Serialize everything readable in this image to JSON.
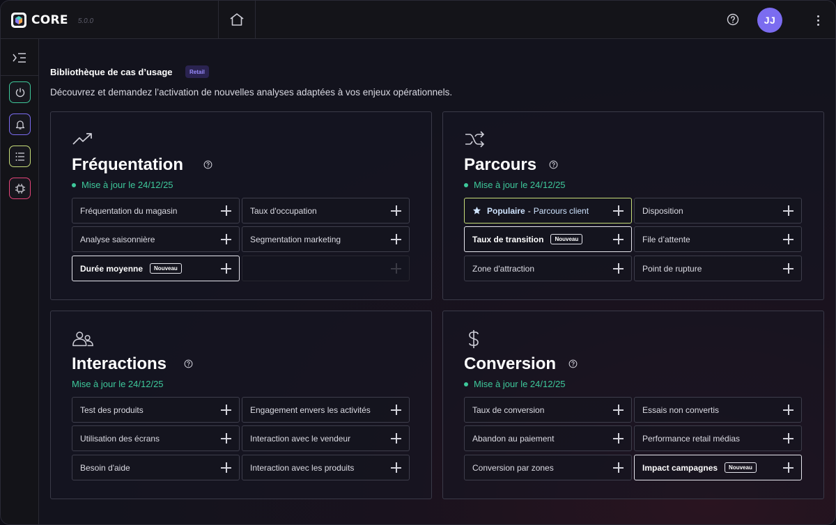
{
  "app": {
    "name": "CORE",
    "version": "5.0.0",
    "avatar_initials": "JJ",
    "accent": "#7b6cf0"
  },
  "icons": {
    "home": "home-icon",
    "help": "help-circle-icon",
    "menu": "kebab-menu-icon",
    "sidebar_toggle": "sidebar-expand-icon",
    "power": "power-icon",
    "bell": "bell-icon",
    "list": "list-icon",
    "chip": "chip-icon"
  },
  "library": {
    "title": "Bibliothèque de cas d’usage",
    "badge": "Retail",
    "description": "Découvrez et demandez l’activation de nouvelles analyses adaptées à vos enjeux opérationnels."
  },
  "labels": {
    "new": "Nouveau",
    "popular": "Populaire",
    "popular_sep": "-"
  },
  "sections": {
    "frequentation": {
      "title": "Fréquentation",
      "icon": "trending-up-icon",
      "status": "Mise à jour le 24/12/25",
      "items": [
        "Fréquentation du magasin",
        "Taux d'occupation",
        "Analyse saisonnière",
        "Segmentation marketing",
        "Durée moyenne"
      ]
    },
    "parcours": {
      "title": "Parcours",
      "icon": "shuffle-icon",
      "status": "Mise à jour le 24/12/25",
      "items": [
        "Parcours client",
        "Disposition",
        "Taux de transition",
        "File d’attente",
        "Zone d'attraction",
        "Point de rupture"
      ]
    },
    "interactions": {
      "title": "Interactions",
      "icon": "users-icon",
      "status": "Mise à jour le 24/12/25",
      "items": [
        "Test des produits",
        "Engagement envers les activités",
        "Utilisation des écrans",
        "Interaction avec le vendeur",
        "Besoin d'aide",
        "Interaction avec les produits"
      ]
    },
    "conversion": {
      "title": "Conversion",
      "icon": "dollar-icon",
      "status": "Mise à jour le 24/12/25",
      "items": [
        "Taux de conversion",
        "Essais non convertis",
        "Abandon au paiement",
        "Performance retail médias",
        "Conversion par zones",
        "Impact campagnes"
      ]
    }
  }
}
